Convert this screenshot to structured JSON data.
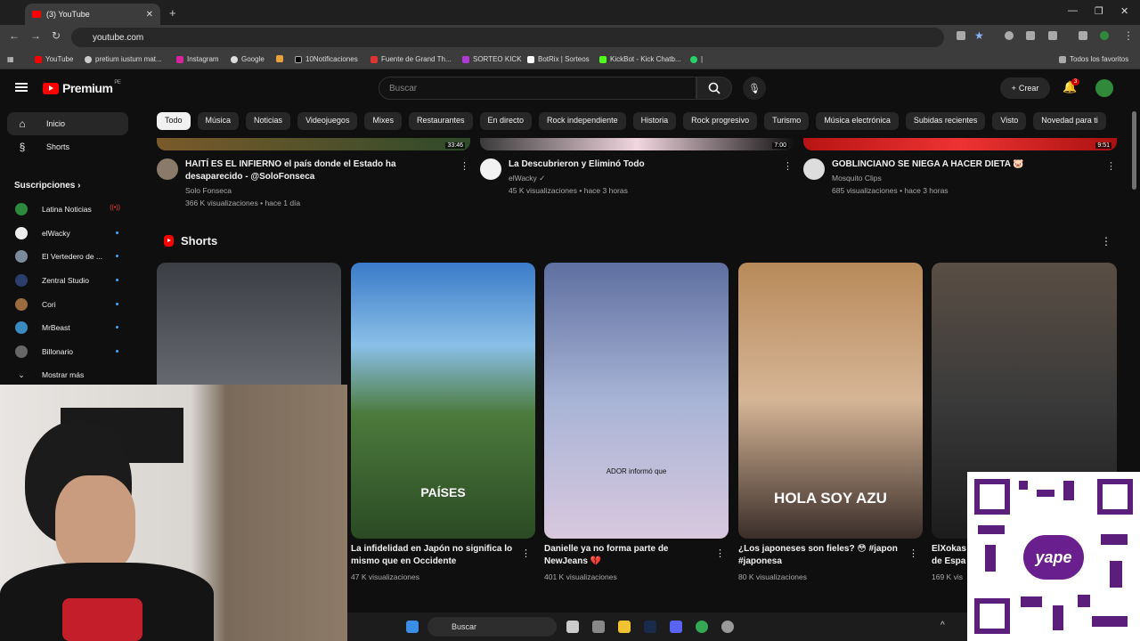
{
  "browser": {
    "tab_title": "(3) YouTube",
    "url": "youtube.com",
    "bookmarks": [
      "YouTube",
      "pretium iustum mat...",
      "Instagram",
      "Google",
      "10Notificaciones",
      "Fuente de Grand Th...",
      "SORTEO KICK",
      "BotRix | Sorteos",
      "KickBot - Kick Chatb...",
      "|"
    ],
    "all_favorites": "Todos los favoritos"
  },
  "header": {
    "logo": "Premium",
    "country": "PE",
    "search_placeholder": "Buscar",
    "create_label": "Crear",
    "notif_count": "3"
  },
  "sidebar": {
    "home": "Inicio",
    "shorts": "Shorts",
    "subs_title": "Suscripciones",
    "subscriptions": [
      "Latina Noticias",
      "elWacky",
      "El Vertedero de ...",
      "Zentral Studio",
      "Cori",
      "MrBeast",
      "Billonario"
    ],
    "show_more": "Mostrar más",
    "live_label": "((•))"
  },
  "chips": [
    "Todo",
    "Música",
    "Noticias",
    "Videojuegos",
    "Mixes",
    "Restaurantes",
    "En directo",
    "Rock independiente",
    "Historia",
    "Rock progresivo",
    "Turismo",
    "Música electrónica",
    "Subidas recientes",
    "Visto",
    "Novedad para ti"
  ],
  "videos": [
    {
      "title": "HAITÍ ES EL INFIERNO el país donde el Estado ha desaparecido - @SoloFonseca",
      "channel": "Solo Fonseca",
      "meta": "366 K visualizaciones • hace 1 día",
      "duration": "33:46"
    },
    {
      "title": "La Descubrieron y Eliminó Todo",
      "channel": "elWacky ✓",
      "meta": "45 K visualizaciones • hace 3 horas",
      "duration": "7:00"
    },
    {
      "title": "GOBLINCIANO SE NIEGA A HACER DIETA 🐷",
      "channel": "Mosquito Clips",
      "meta": "685 visualizaciones • hace 3 horas",
      "duration": "9:51"
    }
  ],
  "shorts_title": "Shorts",
  "shorts": [
    {
      "title": "",
      "views": "",
      "caption": ""
    },
    {
      "title": "La infidelidad en Japón no significa lo mismo que en Occidente",
      "views": "47 K visualizaciones",
      "caption": "PAÍSES"
    },
    {
      "title": "Danielle ya no forma parte de NewJeans 💔",
      "views": "401 K visualizaciones",
      "caption": "ADOR informó que"
    },
    {
      "title": "¿Los japoneses son fieles? 😳 #japon #japonesa",
      "views": "80 K visualizaciones",
      "caption": "HOLA SOY AZU"
    },
    {
      "title": "ElXokas de Espa",
      "views": "169 K vis",
      "caption": ""
    }
  ],
  "overlay": {
    "qr_brand": "yape"
  },
  "taskbar": {
    "search": "Buscar"
  }
}
